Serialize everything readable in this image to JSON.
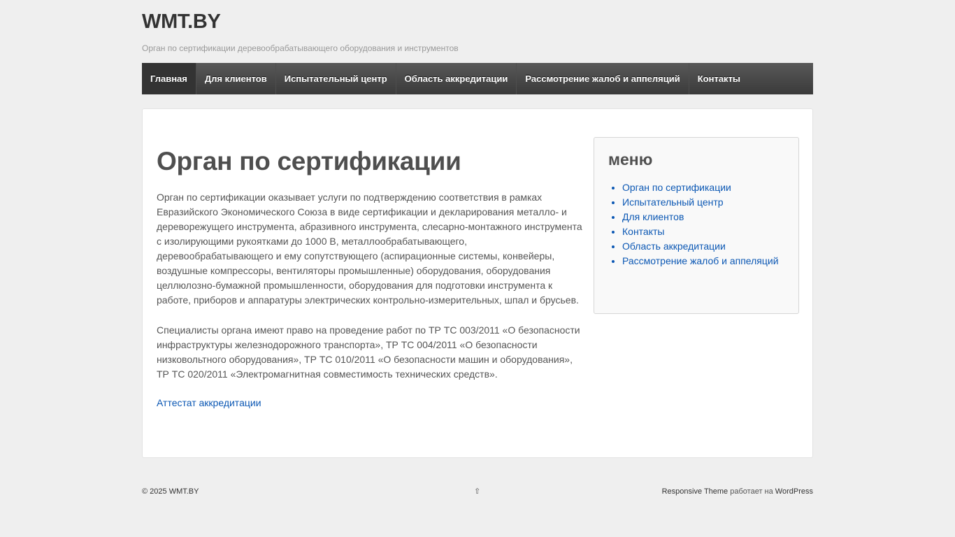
{
  "header": {
    "site_title": "WMT.BY",
    "site_description": "Орган по сертификации деревообрабатывающего оборудования и инструментов"
  },
  "nav": {
    "items": [
      {
        "label": "Главная",
        "active": true
      },
      {
        "label": "Для клиентов"
      },
      {
        "label": "Испытательный центр"
      },
      {
        "label": "Область аккредитации"
      },
      {
        "label": "Рассмотрение жалоб и аппеляций"
      },
      {
        "label": "Контакты"
      }
    ]
  },
  "main": {
    "title": "Орган по сертификации",
    "paragraph1": "Орган по сертификации оказывает услуги по подтверждению соответствия в рамках Евразийского Экономического Союза в виде сертификации и декларирования металло- и дереворежущего инструмента, абразивного инструмента, слесарно-монтажного инструмента с изолирующими рукоятками до 1000 В, металлообрабатывающего, деревообрабатывающего и ему сопутствующего (аспирационные системы, конвейеры, воздушные компрессоры, вентиляторы промышленные) оборудования, оборудования целлюлозно-бумажной промышленности, оборудования для подготовки  инструмента к работе, приборов и аппаратуры электрических контрольно-измерительных, шпал и брусьев.",
    "paragraph2": "Специалисты органа имеют право на проведение работ по ТР ТС 003/2011 «О безопасности инфраструктуры железнодорожного транспорта», ТР ТС 004/2011 «О безопасности низковольтного оборудования», ТР ТС 010/2011 «О безопасности машин и оборудования», ТР ТС 020/2011 «Электромагнитная совместимость технических средств».",
    "link_label": "Аттестат аккредитации"
  },
  "sidebar": {
    "title": "меню",
    "items": [
      {
        "label": "Орган по сертификации"
      },
      {
        "label": "Испытательный центр"
      },
      {
        "label": "Для клиентов"
      },
      {
        "label": "Контакты"
      },
      {
        "label": "Область аккредитации"
      },
      {
        "label": "Рассмотрение жалоб и аппеляций"
      }
    ]
  },
  "footer": {
    "copyright": "© 2025 WMT.BY",
    "scroll_top_glyph": "⇧",
    "theme_name": "Responsive Theme",
    "powered_text": " работает на ",
    "wordpress": "WordPress"
  },
  "colors": {
    "link": "#0c58b4",
    "nav_bg": "#3a3a3a",
    "page_bg": "#efefef"
  }
}
